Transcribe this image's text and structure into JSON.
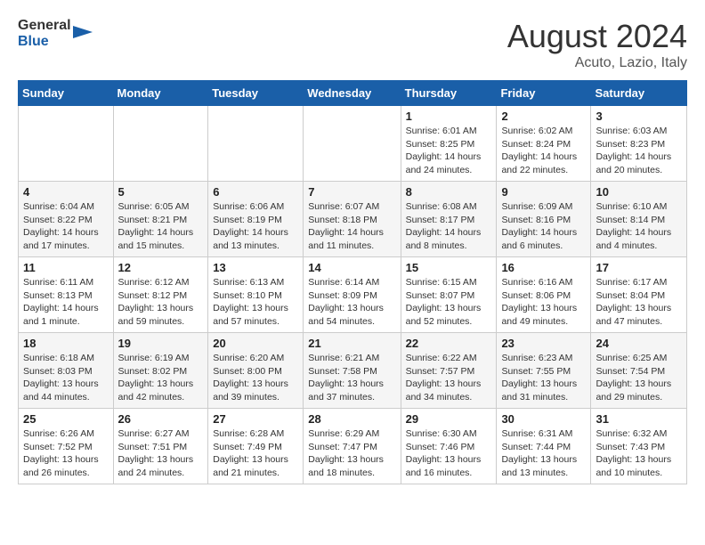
{
  "header": {
    "logo_general": "General",
    "logo_blue": "Blue",
    "month_year": "August 2024",
    "location": "Acuto, Lazio, Italy"
  },
  "calendar": {
    "days_of_week": [
      "Sunday",
      "Monday",
      "Tuesday",
      "Wednesday",
      "Thursday",
      "Friday",
      "Saturday"
    ],
    "weeks": [
      [
        {
          "day": "",
          "info": ""
        },
        {
          "day": "",
          "info": ""
        },
        {
          "day": "",
          "info": ""
        },
        {
          "day": "",
          "info": ""
        },
        {
          "day": "1",
          "info": "Sunrise: 6:01 AM\nSunset: 8:25 PM\nDaylight: 14 hours and 24 minutes."
        },
        {
          "day": "2",
          "info": "Sunrise: 6:02 AM\nSunset: 8:24 PM\nDaylight: 14 hours and 22 minutes."
        },
        {
          "day": "3",
          "info": "Sunrise: 6:03 AM\nSunset: 8:23 PM\nDaylight: 14 hours and 20 minutes."
        }
      ],
      [
        {
          "day": "4",
          "info": "Sunrise: 6:04 AM\nSunset: 8:22 PM\nDaylight: 14 hours and 17 minutes."
        },
        {
          "day": "5",
          "info": "Sunrise: 6:05 AM\nSunset: 8:21 PM\nDaylight: 14 hours and 15 minutes."
        },
        {
          "day": "6",
          "info": "Sunrise: 6:06 AM\nSunset: 8:19 PM\nDaylight: 14 hours and 13 minutes."
        },
        {
          "day": "7",
          "info": "Sunrise: 6:07 AM\nSunset: 8:18 PM\nDaylight: 14 hours and 11 minutes."
        },
        {
          "day": "8",
          "info": "Sunrise: 6:08 AM\nSunset: 8:17 PM\nDaylight: 14 hours and 8 minutes."
        },
        {
          "day": "9",
          "info": "Sunrise: 6:09 AM\nSunset: 8:16 PM\nDaylight: 14 hours and 6 minutes."
        },
        {
          "day": "10",
          "info": "Sunrise: 6:10 AM\nSunset: 8:14 PM\nDaylight: 14 hours and 4 minutes."
        }
      ],
      [
        {
          "day": "11",
          "info": "Sunrise: 6:11 AM\nSunset: 8:13 PM\nDaylight: 14 hours and 1 minute."
        },
        {
          "day": "12",
          "info": "Sunrise: 6:12 AM\nSunset: 8:12 PM\nDaylight: 13 hours and 59 minutes."
        },
        {
          "day": "13",
          "info": "Sunrise: 6:13 AM\nSunset: 8:10 PM\nDaylight: 13 hours and 57 minutes."
        },
        {
          "day": "14",
          "info": "Sunrise: 6:14 AM\nSunset: 8:09 PM\nDaylight: 13 hours and 54 minutes."
        },
        {
          "day": "15",
          "info": "Sunrise: 6:15 AM\nSunset: 8:07 PM\nDaylight: 13 hours and 52 minutes."
        },
        {
          "day": "16",
          "info": "Sunrise: 6:16 AM\nSunset: 8:06 PM\nDaylight: 13 hours and 49 minutes."
        },
        {
          "day": "17",
          "info": "Sunrise: 6:17 AM\nSunset: 8:04 PM\nDaylight: 13 hours and 47 minutes."
        }
      ],
      [
        {
          "day": "18",
          "info": "Sunrise: 6:18 AM\nSunset: 8:03 PM\nDaylight: 13 hours and 44 minutes."
        },
        {
          "day": "19",
          "info": "Sunrise: 6:19 AM\nSunset: 8:02 PM\nDaylight: 13 hours and 42 minutes."
        },
        {
          "day": "20",
          "info": "Sunrise: 6:20 AM\nSunset: 8:00 PM\nDaylight: 13 hours and 39 minutes."
        },
        {
          "day": "21",
          "info": "Sunrise: 6:21 AM\nSunset: 7:58 PM\nDaylight: 13 hours and 37 minutes."
        },
        {
          "day": "22",
          "info": "Sunrise: 6:22 AM\nSunset: 7:57 PM\nDaylight: 13 hours and 34 minutes."
        },
        {
          "day": "23",
          "info": "Sunrise: 6:23 AM\nSunset: 7:55 PM\nDaylight: 13 hours and 31 minutes."
        },
        {
          "day": "24",
          "info": "Sunrise: 6:25 AM\nSunset: 7:54 PM\nDaylight: 13 hours and 29 minutes."
        }
      ],
      [
        {
          "day": "25",
          "info": "Sunrise: 6:26 AM\nSunset: 7:52 PM\nDaylight: 13 hours and 26 minutes."
        },
        {
          "day": "26",
          "info": "Sunrise: 6:27 AM\nSunset: 7:51 PM\nDaylight: 13 hours and 24 minutes."
        },
        {
          "day": "27",
          "info": "Sunrise: 6:28 AM\nSunset: 7:49 PM\nDaylight: 13 hours and 21 minutes."
        },
        {
          "day": "28",
          "info": "Sunrise: 6:29 AM\nSunset: 7:47 PM\nDaylight: 13 hours and 18 minutes."
        },
        {
          "day": "29",
          "info": "Sunrise: 6:30 AM\nSunset: 7:46 PM\nDaylight: 13 hours and 16 minutes."
        },
        {
          "day": "30",
          "info": "Sunrise: 6:31 AM\nSunset: 7:44 PM\nDaylight: 13 hours and 13 minutes."
        },
        {
          "day": "31",
          "info": "Sunrise: 6:32 AM\nSunset: 7:43 PM\nDaylight: 13 hours and 10 minutes."
        }
      ]
    ]
  }
}
